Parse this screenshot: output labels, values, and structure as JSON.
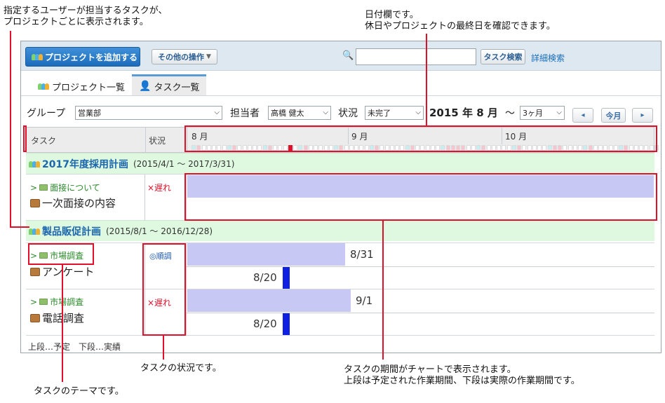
{
  "callouts": {
    "themes_line1": "指定するユーザーが担当するタスクが、",
    "themes_line2": "プロジェクトごとに表示されます。",
    "date_line1": "日付欄です。",
    "date_line2": "休日やプロジェクトの最終日を確認できます。",
    "status": "タスクの状況です。",
    "period_line1": "タスクの期間がチャートで表示されます。",
    "period_line2": "上段は予定された作業期間、下段は実際の作業期間です。",
    "theme": "タスクのテーマです。"
  },
  "toolbar": {
    "add_project": "プロジェクトを追加する",
    "other_actions": "その他の操作",
    "search_value": "",
    "search_button": "タスク検索",
    "advanced_search": "詳細検索"
  },
  "tabs": [
    {
      "label": "プロジェクト一覧",
      "active": false
    },
    {
      "label": "タスク一覧",
      "active": true
    }
  ],
  "filters": {
    "group_label": "グループ",
    "group_value": "営業部",
    "assignee_label": "担当者",
    "assignee_value": "高橋 健太",
    "status_label": "状況",
    "status_value": "未完了",
    "date_display": "2015 年 8 月",
    "tilde": "～",
    "range_value": "3ヶ月",
    "prev": "◂",
    "today": "今月",
    "next": "▸"
  },
  "grid": {
    "col_task": "タスク",
    "col_status": "状況",
    "months": [
      "8 月",
      "9 月",
      "10 月"
    ]
  },
  "projects": [
    {
      "name": "2017年度採用計画",
      "range": "(2015/4/1 ～ 2017/3/31)",
      "tasks": [
        {
          "theme": "> ",
          "theme_name": "面接について",
          "task": "一次面接の内容",
          "status": "×遅れ",
          "status_type": "late",
          "plan_label": "",
          "actual_label": ""
        }
      ]
    },
    {
      "name": "製品販促計画",
      "range": "(2015/8/1 ～ 2016/12/28)",
      "tasks": [
        {
          "theme": "> ",
          "theme_name": "市場調査",
          "task": "アンケート",
          "status": "◎順調",
          "status_type": "ok",
          "plan_label": "8/31",
          "actual_label": "8/20"
        },
        {
          "theme": "> ",
          "theme_name": "市場調査",
          "task": "電話調査",
          "status": "×遅れ",
          "status_type": "late",
          "plan_label": "9/1",
          "actual_label": "8/20"
        }
      ]
    }
  ],
  "legend": "上段…予定　下段…実績",
  "colors": {
    "accent": "#1c6cbc",
    "annotation": "#e0102a",
    "project_row": "#dff8e0",
    "plan_bar": "#c8c8f4",
    "actual_bar": "#1020e0",
    "holiday": "#f6c6cf",
    "weekend": "#c9eef2",
    "today": "#e0102a"
  }
}
